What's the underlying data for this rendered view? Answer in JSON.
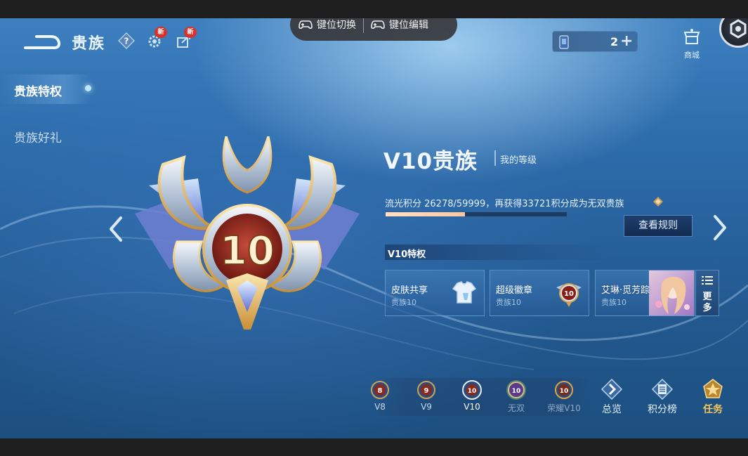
{
  "header": {
    "title": "贵族",
    "help_icon": "question-icon",
    "new_badge": "新"
  },
  "overlay_toolbar": {
    "switch_label": "键位切换",
    "edit_label": "键位编辑"
  },
  "currency": {
    "value": "2",
    "plus": "+"
  },
  "shop": {
    "label": "商城"
  },
  "sidebar": {
    "items": [
      {
        "label": "贵族特权",
        "active": true
      },
      {
        "label": "贵族好礼",
        "active": false
      }
    ]
  },
  "crest": {
    "level": "10"
  },
  "tier": {
    "title": "V10贵族",
    "my_level_label": "我的等级",
    "progress_text": "流光积分 26278/59999，再获得33721积分成为无双贵族",
    "points_current": 26278,
    "points_target": 59999,
    "rules_button": "查看规则"
  },
  "privileges": {
    "header": "V10特权",
    "cards": [
      {
        "name": "皮肤共享",
        "tier": "贵族10"
      },
      {
        "name": "超级徽章",
        "tier": "贵族10"
      },
      {
        "name": "艾琳·觅芳踪",
        "tier": "贵族10"
      }
    ],
    "more_label_1": "更",
    "more_label_2": "多"
  },
  "tier_nav": {
    "items": [
      {
        "label": "V8",
        "badge": "8",
        "state": "normal"
      },
      {
        "label": "V9",
        "badge": "9",
        "state": "normal"
      },
      {
        "label": "V10",
        "badge": "10",
        "state": "current"
      },
      {
        "label": "无双",
        "badge": "10",
        "state": "locked"
      },
      {
        "label": "荣耀V10",
        "badge": "10",
        "state": "locked"
      }
    ]
  },
  "nav": {
    "overview": "总览",
    "rank": "积分榜",
    "tasks": "任务"
  },
  "colors": {
    "accent_gold": "#f3c45b",
    "badge_red": "#d8322c",
    "progress_fill": "#f7c9a8"
  }
}
